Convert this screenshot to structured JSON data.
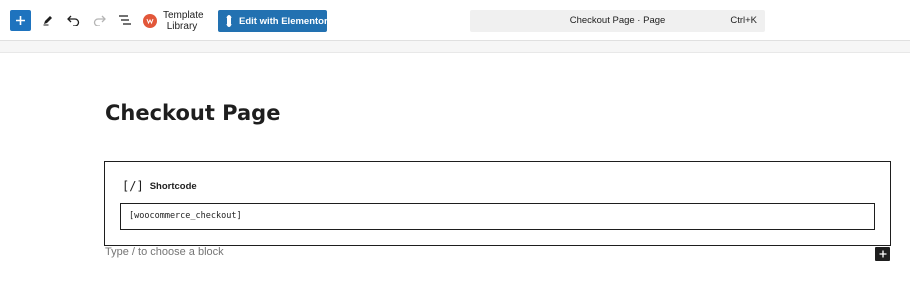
{
  "toolbar": {
    "add_block_icon": "plus-icon",
    "tools_icon": "pencil-icon",
    "undo_icon": "undo-icon",
    "redo_icon": "redo-icon",
    "list_view_icon": "list-view-icon",
    "template_library_label": "Template Library",
    "edit_elementor_label": "Edit with Elementor",
    "command_title": "Checkout Page · Page",
    "command_shortcut": "Ctrl+K",
    "accent_color": "#1e73be"
  },
  "editor": {
    "page_title": "Checkout Page",
    "block": {
      "icon_glyph": "[/]",
      "name": "Shortcode",
      "value": "[woocommerce_checkout]"
    },
    "appender_placeholder": "Type / to choose a block"
  }
}
